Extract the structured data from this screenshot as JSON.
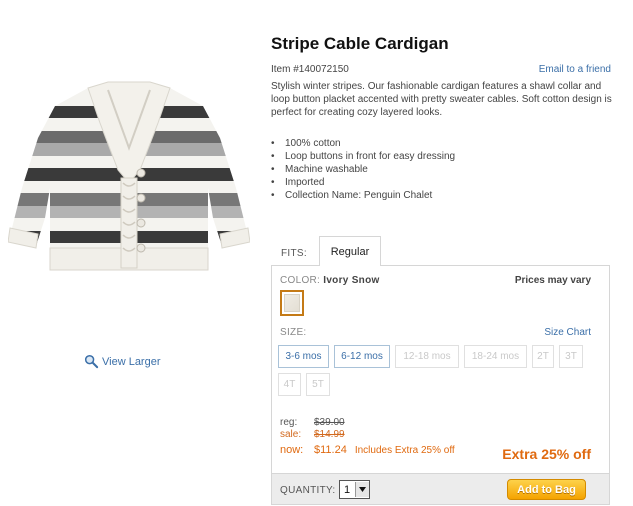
{
  "product": {
    "title": "Stripe Cable Cardigan",
    "item_number": "Item #140072150",
    "email_link": "Email to a friend",
    "description": "Stylish winter stripes. Our fashionable cardigan features a shawl collar and loop button placket accented with pretty sweater cables. Soft cotton design is perfect for creating cozy layered looks.",
    "features": [
      "100% cotton",
      "Loop buttons in front for easy dressing",
      "Machine washable",
      "Imported",
      "Collection Name: Penguin Chalet"
    ],
    "image_alt_icon": "cardigan-image",
    "view_larger": "View Larger"
  },
  "fits": {
    "label": "FITS:",
    "tabs": [
      "Regular"
    ]
  },
  "options": {
    "color_label": "COLOR:",
    "color_value": "Ivory Snow",
    "prices_vary": "Prices may vary",
    "size_label": "SIZE:",
    "size_chart": "Size Chart",
    "sizes": [
      {
        "label": "3-6 mos",
        "available": true
      },
      {
        "label": "6-12 mos",
        "available": true
      },
      {
        "label": "12-18 mos",
        "available": false
      },
      {
        "label": "18-24 mos",
        "available": false
      },
      {
        "label": "2T",
        "available": false
      },
      {
        "label": "3T",
        "available": false
      },
      {
        "label": "4T",
        "available": false
      },
      {
        "label": "5T",
        "available": false
      }
    ]
  },
  "pricing": {
    "reg_label": "reg:",
    "reg_value": "$39.00",
    "sale_label": "sale:",
    "sale_value": "$14.99",
    "now_label": "now:",
    "now_value": "$11.24",
    "now_note": "Includes Extra 25% off",
    "extra_off": "Extra 25% off"
  },
  "cart": {
    "quantity_label": "QUANTITY:",
    "quantity_value": "1",
    "add_button": "Add to Bag"
  },
  "colors": {
    "link": "#3b6fa8",
    "accent_orange": "#e06a10",
    "button_yellow": "#f5a300"
  }
}
